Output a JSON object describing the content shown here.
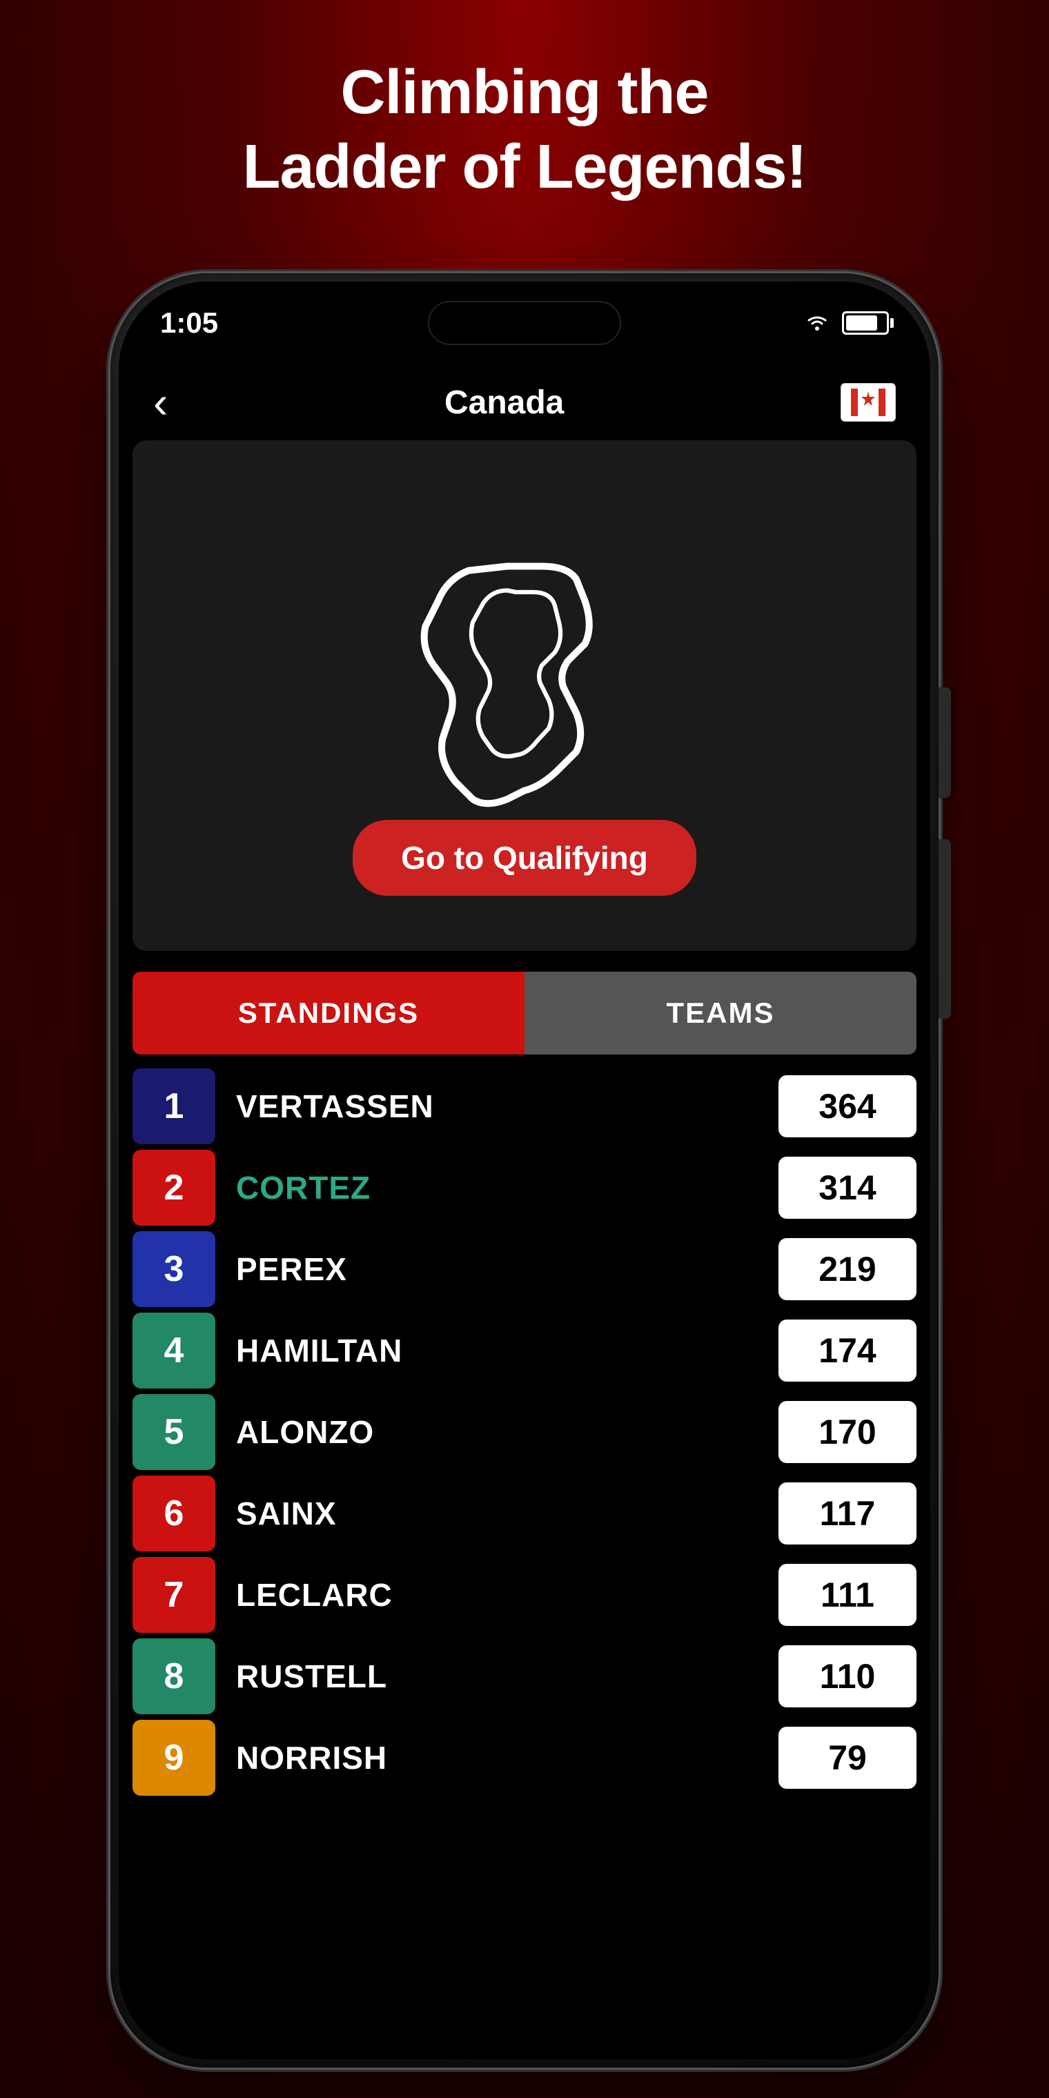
{
  "headline": {
    "line1": "Climbing the",
    "line2": "Ladder of Legends!"
  },
  "status_bar": {
    "time": "1:05",
    "wifi": "📶",
    "battery_pct": 80
  },
  "nav": {
    "back_label": "‹",
    "title": "Canada",
    "flag_emoji": "🍁"
  },
  "qualifying_button": {
    "label": "Go to Qualifying"
  },
  "tabs": {
    "standings_label": "STANDINGS",
    "teams_label": "TEAMS"
  },
  "standings": [
    {
      "pos": "1",
      "name": "VERTASSEN",
      "points": "364",
      "pos_class": "pos-blue-dark",
      "highlight": false
    },
    {
      "pos": "2",
      "name": "CORTEZ",
      "points": "314",
      "pos_class": "pos-red",
      "highlight": true
    },
    {
      "pos": "3",
      "name": "PEREX",
      "points": "219",
      "pos_class": "pos-blue-medium",
      "highlight": false
    },
    {
      "pos": "4",
      "name": "HAMILTAN",
      "points": "174",
      "pos_class": "pos-teal",
      "highlight": false
    },
    {
      "pos": "5",
      "name": "ALONZO",
      "points": "170",
      "pos_class": "pos-teal2",
      "highlight": false
    },
    {
      "pos": "6",
      "name": "SAINX",
      "points": "117",
      "pos_class": "pos-red2",
      "highlight": false
    },
    {
      "pos": "7",
      "name": "LECLARC",
      "points": "111",
      "pos_class": "pos-red3",
      "highlight": false
    },
    {
      "pos": "8",
      "name": "RUSTELL",
      "points": "110",
      "pos_class": "pos-teal3",
      "highlight": false
    },
    {
      "pos": "9",
      "name": "NORRISH",
      "points": "79",
      "pos_class": "pos-orange",
      "highlight": false
    }
  ]
}
